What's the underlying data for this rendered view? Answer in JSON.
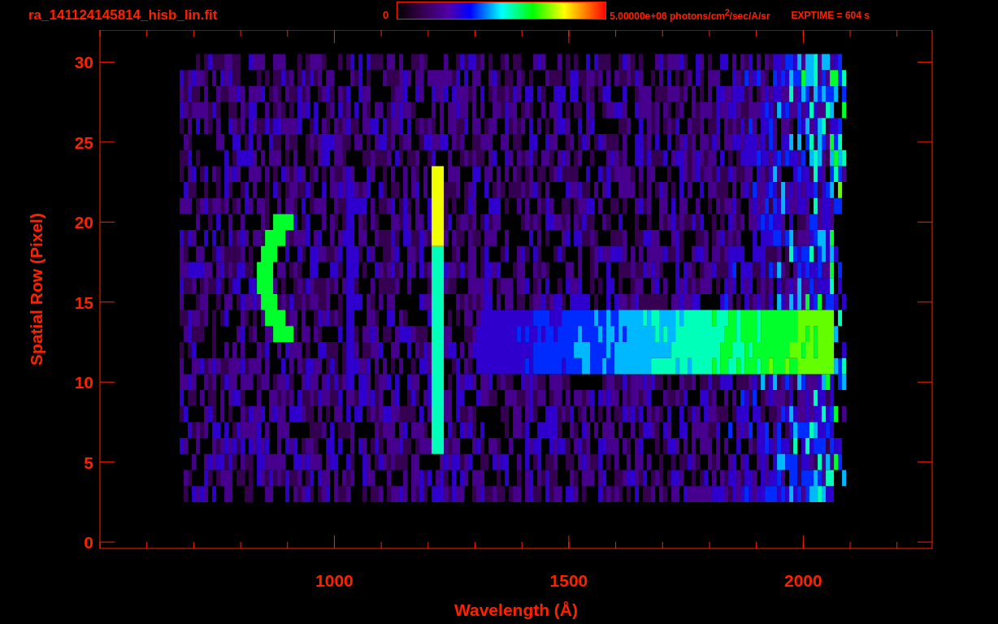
{
  "header": {
    "file_name": "ra_141124145814_hisb_lin.fit",
    "colorbar_min": "0",
    "colorbar_max": "5.00000e+06 photons/cm$^{2}$/sec/A/sr",
    "exposure": "EXPTIME = 604 s"
  },
  "plot": {
    "chart_data": {
      "type": "scatter",
      "xlabel": "Wavelength (Å)",
      "ylabel": "Spatial Row (Pixel)",
      "xlim": [
        500,
        2275
      ],
      "ylim": [
        -0.4,
        32
      ],
      "xticks": [
        {
          "value": 1000,
          "label": "1000"
        },
        {
          "value": 1500,
          "label": "1500"
        },
        {
          "value": 2000,
          "label": "2000"
        }
      ],
      "yticks": [
        {
          "value": 0,
          "label": "0"
        },
        {
          "value": 5,
          "label": "5"
        },
        {
          "value": 10,
          "label": "10"
        },
        {
          "value": 15,
          "label": "15"
        },
        {
          "value": 20,
          "label": "20"
        },
        {
          "value": 25,
          "label": "25"
        },
        {
          "value": 30,
          "label": "30"
        }
      ]
    }
  }
}
